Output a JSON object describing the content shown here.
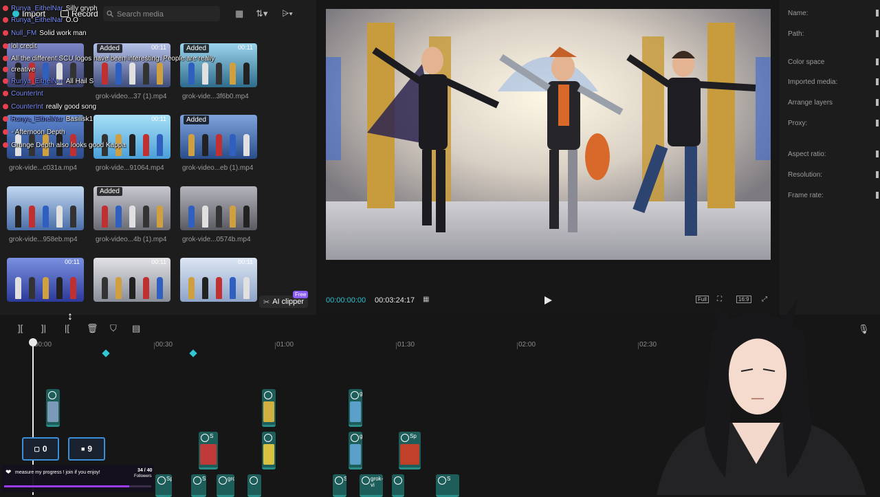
{
  "toolbar": {
    "import_label": "Import",
    "record_label": "Record",
    "search_placeholder": "Search media"
  },
  "chat": [
    {
      "user": "Runya_EithelNar",
      "message": "Silly gryph"
    },
    {
      "user": "Runya_EithelNar",
      "message": "O.O"
    },
    {
      "user": "Null_FM",
      "message": "Solid work man"
    },
    {
      "user": "",
      "message": "lol credit"
    },
    {
      "user": "",
      "message": "All the different SCU logos have been interesting. People are really"
    },
    {
      "user": "",
      "message": "creative"
    },
    {
      "user": "Runya_EithelNar",
      "message": "All Hail S"
    },
    {
      "user": "CounterInt",
      "message": ""
    },
    {
      "user": "CounterInt",
      "message": "really good song"
    },
    {
      "user": "Runya_EithelNar",
      "message": "Basilisk1"
    },
    {
      "user": "",
      "message": "- Afternoon Depth"
    },
    {
      "user": "",
      "message": "Grunge Depth also looks good Kappa"
    }
  ],
  "media": [
    {
      "name": "",
      "duration": "",
      "added": false
    },
    {
      "name": "grok-video...37 (1).mp4",
      "duration": "00:11",
      "added": true
    },
    {
      "name": "grok-vide...3f6b0.mp4",
      "duration": "00:11",
      "added": true
    },
    {
      "name": "grok-vide...c031a.mp4",
      "duration": "",
      "added": false
    },
    {
      "name": "grok-vide...91064.mp4",
      "duration": "00:11",
      "added": false
    },
    {
      "name": "grok-video...eb (1).mp4",
      "duration": "",
      "added": true
    },
    {
      "name": "grok-vide...958eb.mp4",
      "duration": "",
      "added": false
    },
    {
      "name": "grok-video...4b (1).mp4",
      "duration": "",
      "added": true
    },
    {
      "name": "grok-vide...0574b.mp4",
      "duration": "",
      "added": false
    },
    {
      "name": "",
      "duration": "00:11",
      "added": false
    },
    {
      "name": "",
      "duration": "00:11",
      "added": false
    },
    {
      "name": "",
      "duration": "00:11",
      "added": false
    }
  ],
  "added_label": "Added",
  "ai_clipper": {
    "label": "AI clipper",
    "badge": "Free"
  },
  "player": {
    "current_time": "00:00:00:00",
    "total_time": "00:03:24:17",
    "full_label": "Full",
    "ratio_label": "16:9"
  },
  "properties": {
    "labels": [
      "Name:",
      "Path:",
      "Color space",
      "Imported media:",
      "Arrange layers",
      "Proxy:",
      "Aspect ratio:",
      "Resolution:",
      "Frame rate:"
    ]
  },
  "ruler": [
    "00:00",
    "00:30",
    "01:00",
    "01:30",
    "02:00",
    "02:30"
  ],
  "timeline_clips": [
    {
      "label": ""
    },
    {
      "label": ""
    },
    {
      "label": "grok"
    },
    {
      "label": "S"
    },
    {
      "label": ""
    },
    {
      "label": "grok"
    },
    {
      "label": "Sp"
    },
    {
      "label": "Spe"
    },
    {
      "label": "S"
    },
    {
      "label": "grok"
    },
    {
      "label": ""
    },
    {
      "label": "S"
    },
    {
      "label": "grok-vi"
    },
    {
      "label": ""
    },
    {
      "label": "S"
    }
  ],
  "counters": {
    "left_value": "0",
    "right_value": "9"
  },
  "followers": {
    "text": "measure my progress ! join if you enjoy!",
    "count": "34 / 40",
    "label": "Followers",
    "progress": 0.85
  },
  "colors": {
    "accent": "#2fc1cf",
    "panel": "#1d1d1d",
    "badge": "#8a5cf6"
  }
}
